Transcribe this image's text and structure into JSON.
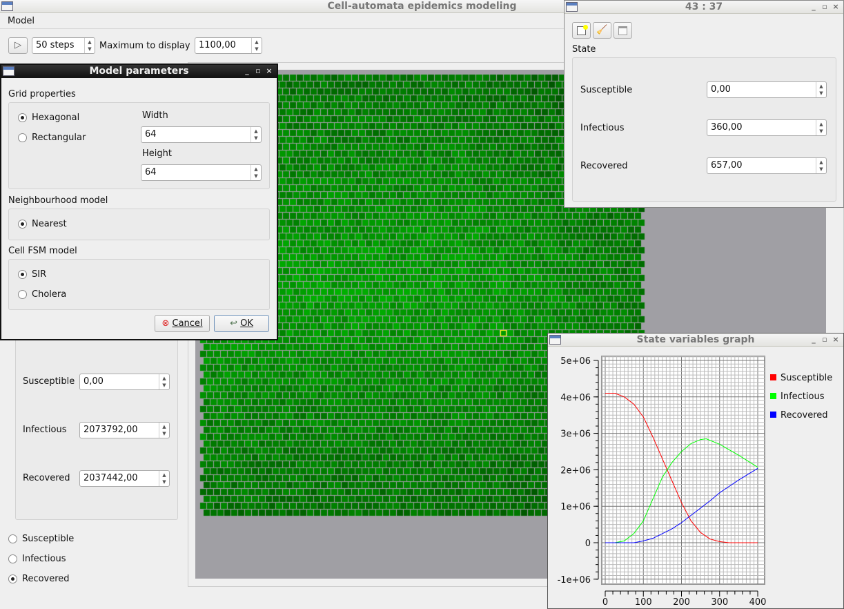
{
  "main": {
    "title": "Cell-automata epidemics modeling",
    "menu": [
      "Model"
    ],
    "toolbar": {
      "play_icon": "play-icon",
      "steps": "50 steps",
      "max_label": "Maximum to display",
      "max_value": "1100,00"
    },
    "left_panel": {
      "fields": [
        {
          "label": "Susceptible",
          "value": "0,00"
        },
        {
          "label": "Infectious",
          "value": "2073792,00"
        },
        {
          "label": "Recovered",
          "value": "2037442,00"
        }
      ],
      "radios": [
        {
          "label": "Susceptible",
          "checked": false
        },
        {
          "label": "Infectious",
          "checked": false
        },
        {
          "label": "Recovered",
          "checked": true
        }
      ]
    },
    "grid": {
      "rows": 64,
      "cols": 64,
      "highlight_color": "#ffff00"
    }
  },
  "params": {
    "title": "Model parameters",
    "grid_props": "Grid properties",
    "shapes": [
      {
        "label": "Hexagonal",
        "checked": true
      },
      {
        "label": "Rectangular",
        "checked": false
      }
    ],
    "width_label": "Width",
    "width": "64",
    "height_label": "Height",
    "height": "64",
    "neigh_label": "Neighbourhood model",
    "neigh": [
      {
        "label": "Nearest",
        "checked": true
      }
    ],
    "fsm_label": "Cell FSM model",
    "fsm": [
      {
        "label": "SIR",
        "checked": true
      },
      {
        "label": "Cholera",
        "checked": false
      }
    ],
    "cancel": "Cancel",
    "ok": "OK"
  },
  "state": {
    "title": "43 : 37",
    "group_label": "State",
    "tools": [
      "new-icon",
      "broom-icon",
      "window-icon"
    ],
    "fields": [
      {
        "label": "Susceptible",
        "value": "0,00"
      },
      {
        "label": "Infectious",
        "value": "360,00"
      },
      {
        "label": "Recovered",
        "value": "657,00"
      }
    ]
  },
  "graph": {
    "title": "State variables graph"
  },
  "chart_data": {
    "type": "line",
    "title": "",
    "xlabel": "",
    "ylabel": "",
    "xlim": [
      0,
      400
    ],
    "ylim": [
      -1000000,
      5000000
    ],
    "grid": true,
    "legend": "right",
    "xticks": [
      "0",
      "100",
      "200",
      "300",
      "400"
    ],
    "yticks": [
      "5e+06",
      "4e+06",
      "3e+06",
      "2e+06",
      "1e+06",
      "0",
      "-1e+06"
    ],
    "series": [
      {
        "name": "Susceptible",
        "color": "#ff0000",
        "x": [
          0,
          25,
          50,
          75,
          100,
          125,
          150,
          175,
          200,
          225,
          250,
          275,
          300,
          325,
          400
        ],
        "y": [
          4100000,
          4100000,
          4000000,
          3800000,
          3450000,
          2900000,
          2300000,
          1700000,
          1100000,
          600000,
          280000,
          100000,
          30000,
          0,
          0
        ]
      },
      {
        "name": "Infectious",
        "color": "#00ff00",
        "x": [
          25,
          50,
          75,
          100,
          125,
          150,
          175,
          200,
          225,
          250,
          265,
          300,
          350,
          400
        ],
        "y": [
          0,
          50000,
          250000,
          600000,
          1200000,
          1800000,
          2200000,
          2500000,
          2720000,
          2830000,
          2850000,
          2700000,
          2400000,
          2070000
        ]
      },
      {
        "name": "Recovered",
        "color": "#0000ff",
        "x": [
          0,
          75,
          100,
          125,
          150,
          175,
          200,
          225,
          250,
          275,
          300,
          350,
          400
        ],
        "y": [
          0,
          0,
          50000,
          120000,
          250000,
          380000,
          550000,
          750000,
          950000,
          1150000,
          1370000,
          1720000,
          2040000
        ]
      }
    ]
  }
}
